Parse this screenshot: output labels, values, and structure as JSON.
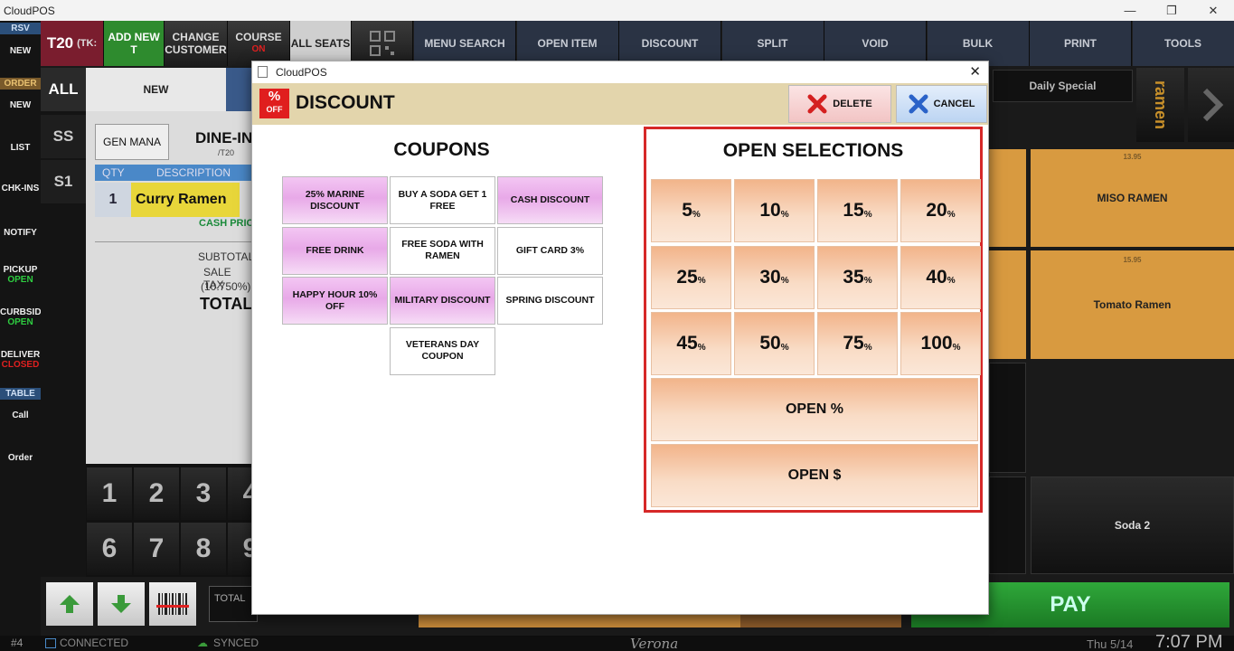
{
  "app": {
    "title": "CloudPOS",
    "controls": [
      "—",
      "❐",
      "✕"
    ]
  },
  "left_rail": {
    "items": [
      {
        "label": "RSV",
        "kind": "tag",
        "color": "#2b4f7a"
      },
      {
        "label": "NEW",
        "kind": "item"
      },
      {
        "label": "ORDER",
        "kind": "tag",
        "color": "#7a5a2b"
      },
      {
        "label": "NEW",
        "kind": "item"
      },
      {
        "label": "LIST",
        "kind": "item"
      },
      {
        "label": "CHK-INS",
        "kind": "item"
      },
      {
        "label": "NOTIFY",
        "kind": "item"
      },
      {
        "label": "PICKUP",
        "kind": "item",
        "sub": "OPEN",
        "sub_color": "#2ecc40"
      },
      {
        "label": "CURBSID",
        "kind": "item",
        "sub": "OPEN",
        "sub_color": "#2ecc40"
      },
      {
        "label": "DELIVER",
        "kind": "item",
        "sub": "CLOSED",
        "sub_color": "#e02020"
      },
      {
        "label": "TABLE",
        "kind": "tag",
        "color": "#2b4f7a"
      },
      {
        "label": "Call",
        "kind": "item"
      },
      {
        "label": "Order",
        "kind": "item"
      }
    ]
  },
  "top_bar": {
    "table": "T20",
    "table_suffix": "(TK:",
    "add_new": "ADD NEW T",
    "change_customer": "CHANGE CUSTOMER",
    "course": "COURSE",
    "course_state": "ON",
    "all_seats": "ALL SEATS",
    "actions": [
      "MENU SEARCH",
      "OPEN ITEM",
      "DISCOUNT",
      "SPLIT",
      "VOID",
      "BULK",
      "PRINT",
      "TOOLS"
    ]
  },
  "order_panel": {
    "seat_tabs": [
      "ALL",
      "SS",
      "S1"
    ],
    "new_tab": "NEW",
    "server": "GEN MANA",
    "order_type": "DINE-IN",
    "table_ref": "/T20",
    "columns": [
      "QTY",
      "DESCRIPTION"
    ],
    "line": {
      "qty": "1",
      "description": "Curry Ramen",
      "note": "CASH PRICE"
    },
    "subtotal_label": "SUBTOTAL",
    "tax_label": "SALE TAX",
    "tax_rate": "(10.750%)",
    "total_label": "TOTAL",
    "keypad": [
      "1",
      "2",
      "3",
      "4",
      "6",
      "7",
      "8",
      "9"
    ],
    "total_field": "TOTAL"
  },
  "right_grid": {
    "category": "Daily Special",
    "side_tab": "ramen",
    "items": [
      {
        "name": "MISO RAMEN",
        "price": "13.95"
      },
      {
        "name": "Tomato Ramen",
        "price": "15.95"
      },
      {
        "name": "Soda 2",
        "price": ""
      }
    ],
    "pay_label": "PAY"
  },
  "status": {
    "station": "#4",
    "connection": "CONNECTED",
    "sync": "SYNCED",
    "location": "Verona",
    "date": "Thu 5/14",
    "time": "7:07 PM"
  },
  "modal": {
    "window_title": "CloudPOS",
    "header_icon_top": "%",
    "header_icon_bottom": "OFF",
    "header": "DISCOUNT",
    "delete_label": "DELETE",
    "cancel_label": "CANCEL",
    "coupons_title": "COUPONS",
    "coupons": [
      {
        "label": "25% MARINE DISCOUNT",
        "style": "pink"
      },
      {
        "label": "BUY A SODA GET 1 FREE",
        "style": "white"
      },
      {
        "label": "CASH DISCOUNT",
        "style": "pink"
      },
      {
        "label": "FREE DRINK",
        "style": "pink"
      },
      {
        "label": "FREE SODA WITH RAMEN",
        "style": "white"
      },
      {
        "label": "GIFT CARD 3%",
        "style": "white"
      },
      {
        "label": "HAPPY HOUR 10% OFF",
        "style": "pink"
      },
      {
        "label": "MILITARY DISCOUNT",
        "style": "pink"
      },
      {
        "label": "SPRING DISCOUNT",
        "style": "white"
      },
      {
        "label": "",
        "style": "none"
      },
      {
        "label": "VETERANS DAY COUPON",
        "style": "white"
      }
    ],
    "open_title": "OPEN SELECTIONS",
    "percents": [
      "5",
      "10",
      "15",
      "20",
      "25",
      "30",
      "35",
      "40",
      "45",
      "50",
      "75",
      "100"
    ],
    "percent_unit": "%",
    "open_percent": "OPEN %",
    "open_dollar": "OPEN $"
  }
}
